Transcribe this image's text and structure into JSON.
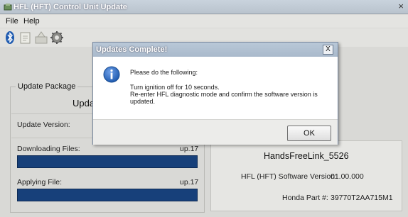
{
  "window": {
    "title": "HFL (HFT) Control Unit Update",
    "close_glyph": "×"
  },
  "menu": {
    "items": [
      "File",
      "Help"
    ]
  },
  "toolbar": {
    "icons": [
      "bluetooth-icon",
      "notepad-icon",
      "update-icon",
      "settings-gear-icon"
    ]
  },
  "update_package": {
    "group_label": "Update Package",
    "title_partial": "Upda",
    "version_label": "Update Version:",
    "downloading_label": "Downloading Files:",
    "downloading_value": "up.17",
    "downloading_progress": 1.0,
    "applying_label": "Applying File:",
    "applying_value": "up.17",
    "applying_progress": 1.0
  },
  "device": {
    "name": "HandsFreeLink_5526",
    "sw_version_label": "HFL (HFT) Software Version:",
    "sw_version_value": "01.00.000",
    "part_label": "Honda Part #:",
    "part_value": "39770T2AA715M1"
  },
  "dialog": {
    "title": "Updates Complete!",
    "close_glyph": "X",
    "message_heading": "Please do the following:",
    "instruction_1": "Turn ignition off for 10 seconds.",
    "instruction_2": "Re-enter HFL diagnostic mode and confirm the software version is",
    "instruction_3": "updated.",
    "ok_label": "OK"
  },
  "colors": {
    "progress_fill": "#17407a",
    "dialog_title_bg": "#b9c8d8",
    "info_icon": "#1f5bb0"
  }
}
